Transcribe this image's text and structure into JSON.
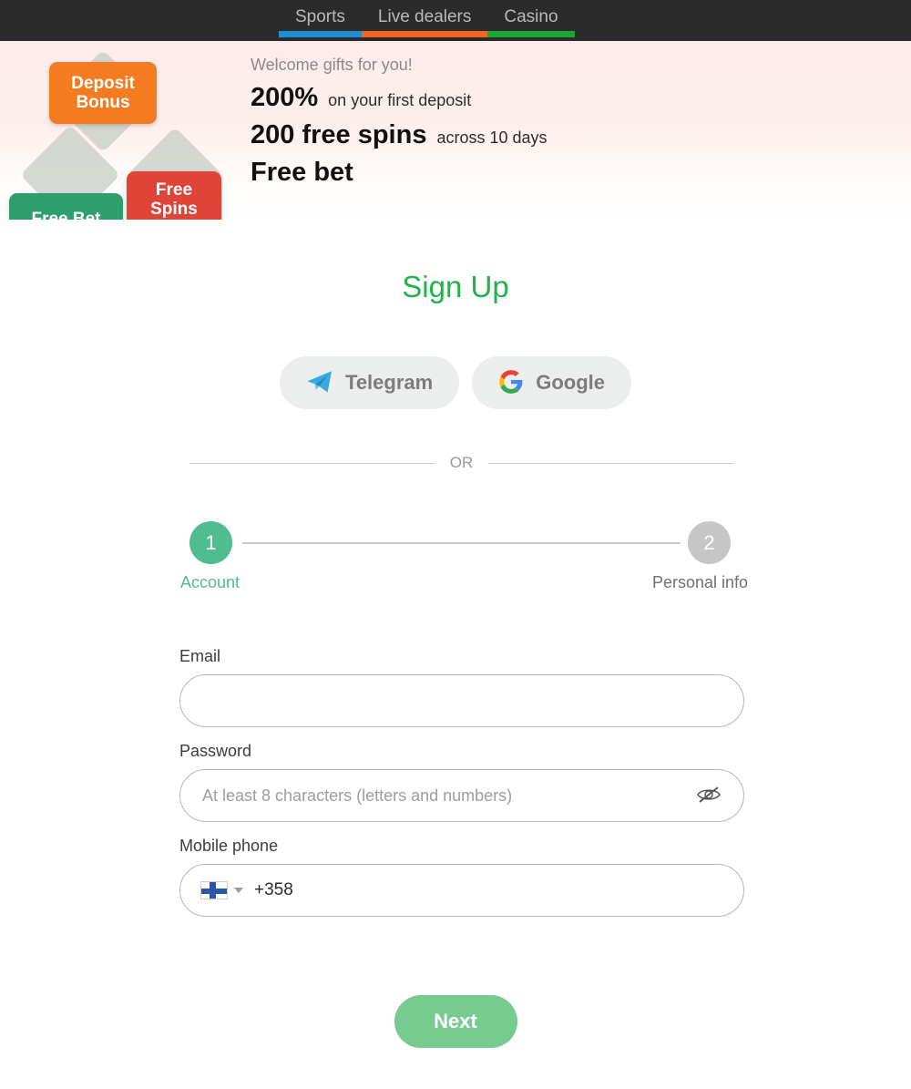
{
  "nav": {
    "tabs": [
      {
        "label": "Sports",
        "underline_color": "#1f8ed6"
      },
      {
        "label": "Live dealers",
        "underline_color": "#f4641e"
      },
      {
        "label": "Casino",
        "underline_color": "#1aa832"
      }
    ]
  },
  "banner": {
    "welcome": "Welcome gifts for you!",
    "offers": [
      {
        "strong": "200%",
        "weak": "on your first deposit"
      },
      {
        "strong": "200 free spins",
        "weak": "across 10 days"
      },
      {
        "strong": "Free bet",
        "weak": ""
      }
    ],
    "badges": [
      {
        "line1": "Deposit",
        "line2": "Bonus",
        "color": "#f47b20"
      },
      {
        "line1": "Free",
        "line2": "Spins",
        "color": "#e04438"
      },
      {
        "line1": "Free Bet",
        "line2": "",
        "color": "#2f9e6e"
      }
    ]
  },
  "signup": {
    "title": "Sign Up",
    "social": [
      {
        "label": "Telegram",
        "icon": "telegram-icon"
      },
      {
        "label": "Google",
        "icon": "google-icon"
      }
    ],
    "divider_text": "OR",
    "steps": [
      {
        "number": "1",
        "label": "Account",
        "color": "#4fbd8f",
        "state": "active"
      },
      {
        "number": "2",
        "label": "Personal info",
        "color": "#c6c6c6",
        "state": "inactive"
      }
    ],
    "fields": {
      "email": {
        "label": "Email",
        "value": "",
        "placeholder": ""
      },
      "password": {
        "label": "Password",
        "value": "",
        "placeholder": "At least 8 characters (letters and numbers)",
        "toggle_icon": "eye-slash-icon"
      },
      "phone": {
        "label": "Mobile phone",
        "value": "",
        "placeholder": "",
        "country_flag": "finland-flag-icon",
        "dial_code": "+358"
      }
    },
    "next_label": "Next"
  },
  "colors": {
    "accent_green": "#21b34a",
    "button_green": "#76cc8e",
    "step_green": "#4fbd8f",
    "nav_bg": "#2b2b2b"
  }
}
